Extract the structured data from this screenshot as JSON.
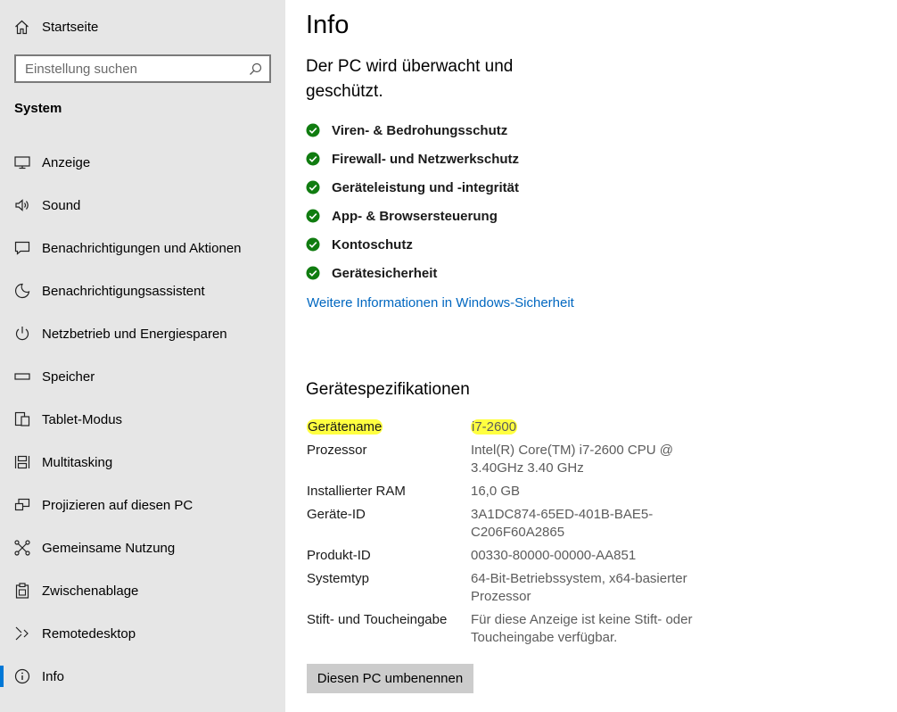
{
  "sidebar": {
    "home_label": "Startseite",
    "search": {
      "placeholder": "Einstellung suchen",
      "value": ""
    },
    "section_title": "System",
    "items": [
      {
        "label": "Anzeige",
        "icon": "monitor-icon"
      },
      {
        "label": "Sound",
        "icon": "speaker-icon"
      },
      {
        "label": "Benachrichtigungen und Aktionen",
        "icon": "notification-icon"
      },
      {
        "label": "Benachrichtigungsassistent",
        "icon": "moon-icon"
      },
      {
        "label": "Netzbetrieb und Energiesparen",
        "icon": "power-icon"
      },
      {
        "label": "Speicher",
        "icon": "storage-icon"
      },
      {
        "label": "Tablet-Modus",
        "icon": "tablet-icon"
      },
      {
        "label": "Multitasking",
        "icon": "multitasking-icon"
      },
      {
        "label": "Projizieren auf diesen PC",
        "icon": "project-icon"
      },
      {
        "label": "Gemeinsame Nutzung",
        "icon": "share-icon"
      },
      {
        "label": "Zwischenablage",
        "icon": "clipboard-icon"
      },
      {
        "label": "Remotedesktop",
        "icon": "remote-desktop-icon"
      },
      {
        "label": "Info",
        "icon": "info-icon",
        "active": true
      }
    ]
  },
  "main": {
    "title": "Info",
    "protection_heading": "Der PC wird überwacht und geschützt.",
    "protection_items": [
      "Viren- & Bedrohungsschutz",
      "Firewall- und Netzwerkschutz",
      "Geräteleistung und -integrität",
      "App- & Browsersteuerung",
      "Kontoschutz",
      "Gerätesicherheit"
    ],
    "security_link": "Weitere Informationen in Windows-Sicherheit",
    "specs_title": "Gerätespezifikationen",
    "specs": [
      {
        "key": "Gerätename",
        "value": "i7-2600",
        "highlighted": true
      },
      {
        "key": "Prozessor",
        "value": "Intel(R) Core(TM) i7-2600 CPU @ 3.40GHz   3.40 GHz"
      },
      {
        "key": "Installierter RAM",
        "value": "16,0 GB"
      },
      {
        "key": "Geräte-ID",
        "value": "3A1DC874-65ED-401B-BAE5-C206F60A2865"
      },
      {
        "key": "Produkt-ID",
        "value": "00330-80000-00000-AA851"
      },
      {
        "key": "Systemtyp",
        "value": "64-Bit-Betriebssystem, x64-basierter Prozessor"
      },
      {
        "key": "Stift- und Toucheingabe",
        "value": "Für diese Anzeige ist keine Stift- oder Toucheingabe verfügbar."
      }
    ],
    "rename_button": "Diesen PC umbenennen"
  },
  "colors": {
    "sidebar_bg": "#e6e6e6",
    "accent": "#0078d7",
    "link": "#0067c0",
    "check_green": "#107c10",
    "highlight": "#ffff40"
  }
}
